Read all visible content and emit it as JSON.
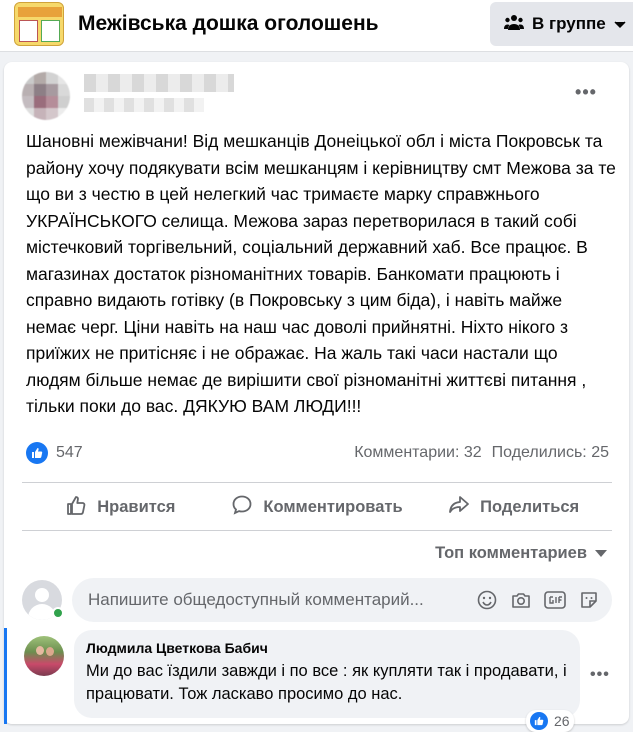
{
  "header": {
    "group_title": "Межівська дошка оголошень",
    "in_group_label": "В группе"
  },
  "post": {
    "more_label": "•••",
    "text": "Шановні межівчани! Від мешканців Донеіцької обл і міста Покровськ та району хочу подякувати всім мешканцям і керівництву смт Межова за те що ви з честю в цей нелегкий час тримаєте марку справжнього УКРАЇНСЬКОГО селища. Межова зараз перетворилася в такий собі містечковий торгівельний, соціальний державний хаб. Все працює. В магазинах достаток різноманітних товарів. Банкомати працюють і справно видають готівку (в Покровську з цим біда), і навіть майже немає черг. Ціни навіть на наш час доволі прийнятні. Ніхто нікого з приїжих не притісняє і не ображає. На жаль такі часи настали що людям більше немає де вирішити свої різноманітні життєві питання , тільки поки до вас. ДЯКУЮ ВАМ ЛЮДИ!!!",
    "reaction_count": "547",
    "comments_stat": "Комментарии: 32",
    "shares_stat": "Поделились: 25"
  },
  "actions": {
    "like": "Нравится",
    "comment": "Комментировать",
    "share": "Поделиться"
  },
  "comments_section": {
    "sort_label": "Топ комментариев",
    "input_placeholder": "Напишите общедоступный комментарий..."
  },
  "comments": [
    {
      "author": "Людмила Цветкова Бабич",
      "text": "Ми до вас їздили завжди і по все : як купляти так і продавати, і працювати. Тож ласкаво просимо до нас.",
      "reaction_count": "26"
    }
  ],
  "colors": {
    "accent": "#1877f2",
    "muted_text": "#65676b",
    "background": "#f0f2f5",
    "online": "#31a24c"
  }
}
